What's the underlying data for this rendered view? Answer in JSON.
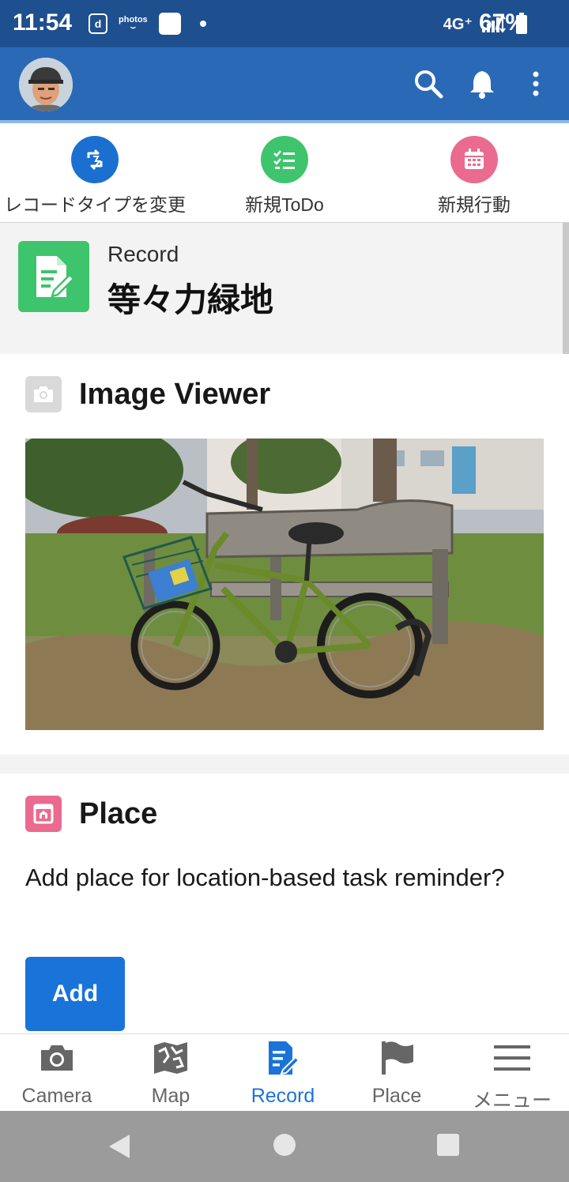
{
  "status_bar": {
    "time": "11:54",
    "left_icons": [
      "docomo-d-icon",
      "amazon-photos-icon",
      "app-notification-icon",
      "dot-icon"
    ],
    "network": "4G⁺",
    "battery": "67%"
  },
  "app_bar": {
    "icons": [
      "avatar",
      "search-icon",
      "bell-icon",
      "more-vert-icon"
    ],
    "brand_color": "#2a69b6"
  },
  "quick_actions": [
    {
      "label": "レコードタイプを変更",
      "icon": "swap-icon",
      "color": "#1b6fd0"
    },
    {
      "label": "新規ToDo",
      "icon": "checklist-icon",
      "color": "#3ec46d"
    },
    {
      "label": "新規行動",
      "icon": "calendar-icon",
      "color": "#ea6b8f"
    }
  ],
  "record": {
    "type_label": "Record",
    "title": "等々力緑地"
  },
  "image_viewer": {
    "title": "Image Viewer",
    "photo_subject": "green bicycle with blue basket leaning against a wooden park bench in tall grass"
  },
  "place": {
    "title": "Place",
    "prompt": "Add place for location-based task reminder?",
    "add_label": "Add"
  },
  "bottom_nav": [
    {
      "label": "Camera",
      "icon": "camera-icon",
      "active": false
    },
    {
      "label": "Map",
      "icon": "map-icon",
      "active": false
    },
    {
      "label": "Record",
      "icon": "record-icon",
      "active": true
    },
    {
      "label": "Place",
      "icon": "flag-icon",
      "active": false
    },
    {
      "label": "メニュー",
      "icon": "hamburger-icon",
      "active": false
    }
  ],
  "system_nav": [
    "back-icon",
    "home-icon",
    "recents-icon"
  ]
}
